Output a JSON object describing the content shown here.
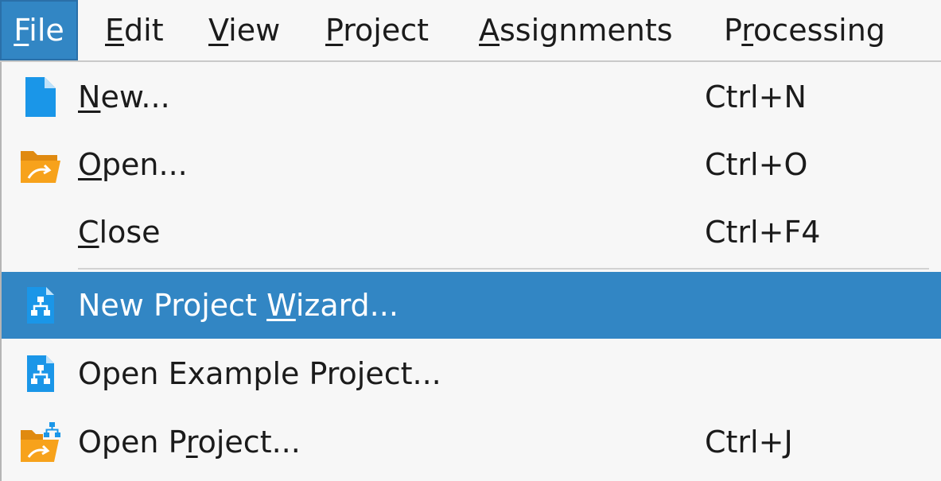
{
  "menubar": {
    "items": [
      {
        "id": "file",
        "pre": "",
        "mnemonic": "F",
        "post": "ile",
        "active": true
      },
      {
        "id": "edit",
        "pre": "",
        "mnemonic": "E",
        "post": "dit",
        "active": false
      },
      {
        "id": "view",
        "pre": "",
        "mnemonic": "V",
        "post": "iew",
        "active": false
      },
      {
        "id": "project",
        "pre": "",
        "mnemonic": "P",
        "post": "roject",
        "active": false
      },
      {
        "id": "assignments",
        "pre": "",
        "mnemonic": "A",
        "post": "ssignments",
        "active": false
      },
      {
        "id": "processing",
        "pre": "P",
        "mnemonic": "r",
        "post": "ocessing",
        "active": false
      }
    ]
  },
  "file_menu": {
    "items": [
      {
        "id": "new",
        "pre": "",
        "mnemonic": "N",
        "post": "ew...",
        "shortcut": "Ctrl+N",
        "icon": "new-file-icon",
        "highlighted": false
      },
      {
        "id": "open",
        "pre": "",
        "mnemonic": "O",
        "post": "pen...",
        "shortcut": "Ctrl+O",
        "icon": "open-folder-icon",
        "highlighted": false
      },
      {
        "id": "close",
        "pre": "",
        "mnemonic": "C",
        "post": "lose",
        "shortcut": "Ctrl+F4",
        "icon": "",
        "highlighted": false
      },
      {
        "id": "new-project-wizard",
        "pre": "New Project ",
        "mnemonic": "W",
        "post": "izard...",
        "shortcut": "",
        "icon": "project-wizard-icon",
        "highlighted": true
      },
      {
        "id": "open-example-project",
        "pre": "Open Example Project...",
        "mnemonic": "",
        "post": "",
        "shortcut": "",
        "icon": "example-project-icon",
        "highlighted": false
      },
      {
        "id": "open-project",
        "pre": "Open P",
        "mnemonic": "r",
        "post": "oject...",
        "shortcut": "Ctrl+J",
        "icon": "open-project-icon",
        "highlighted": false
      }
    ]
  },
  "colors": {
    "highlight": "#3286c4",
    "menu_background": "#f7f7f7",
    "text": "#1b1b1b",
    "icon_blue": "#1a96e8",
    "icon_orange": "#f7a21b"
  }
}
